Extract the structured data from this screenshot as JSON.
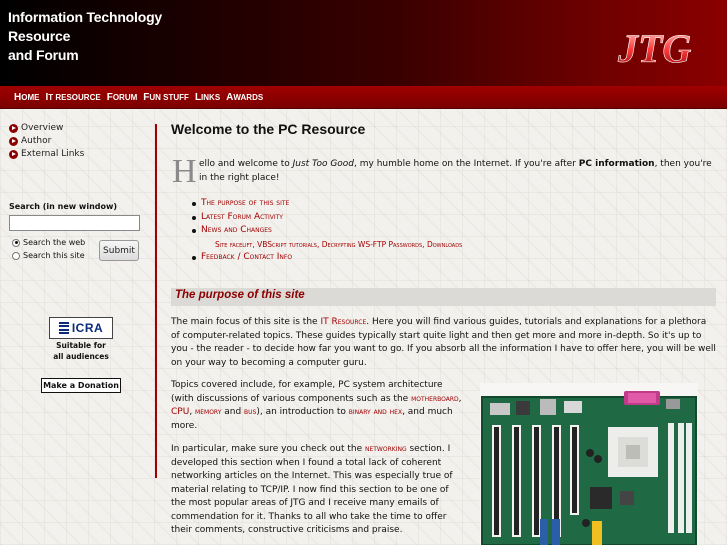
{
  "header": {
    "title_lines": [
      "Information Technology",
      "Resource",
      "and Forum"
    ],
    "logo_text": "JTG"
  },
  "nav": {
    "items": [
      "Home",
      "IT Resource",
      "Forum",
      "Fun Stuff",
      "Links",
      "Awards"
    ]
  },
  "sidebar": {
    "links": [
      "Overview",
      "Author",
      "External Links"
    ],
    "search": {
      "label": "Search (in new window)",
      "value": "",
      "options": [
        "Search the web",
        "Search this site"
      ],
      "selected": "Search the web",
      "submit_label": "Submit"
    },
    "icra": {
      "badge": "ICRA",
      "caption_line1": "Suitable for",
      "caption_line2": "all audiences"
    },
    "donate_label": "Make a Donation"
  },
  "main": {
    "title": "Welcome to the PC Resource",
    "intro": {
      "dropcap": "H",
      "part1": "ello and welcome to ",
      "site_name": "Just Too Good",
      "part2": ", my humble home on the Internet. If you're after ",
      "bold": "PC information",
      "part3": ", then you're in the right place!"
    },
    "toc": [
      "The purpose of this site",
      "Latest Forum Activity",
      "News and Changes",
      "Feedback / Contact Info"
    ],
    "toc_sub": [
      "Site facelift",
      "VBScript tutorials",
      "Decrypting WS-FTP Passwords",
      "Downloads"
    ],
    "section_heading": "The purpose of this site",
    "para1": {
      "a": "The main focus of this site is the ",
      "link": "IT Resource",
      "b": ". Here you will find various guides, tutorials and explanations for a plethora of computer-related topics. These guides typically start quite light and then get more and more in-depth. So it's up to you - the reader - to decide how far you want to go. If you absorb all the information I have to offer here, you will be well on your way to becoming a computer guru."
    },
    "para2": {
      "a": "Topics covered include, for example, PC system architecture (with discussions of various components such as the ",
      "l1": "motherboard",
      "s1": ",",
      "l2": "CPU",
      "s2": ", ",
      "l3": "memory",
      "s3": " and ",
      "l4": "bus",
      "s4": "), an introduction to ",
      "l5": "binary and hex",
      "b": ", and much more."
    },
    "para3": {
      "a": "In particular, make sure you check out the ",
      "link": "networking",
      "b": " section. I developed this section when I found a total lack of coherent networking articles on the Internet. This was especially true of material relating to TCP/IP. I now find this section to be one of the most popular areas of JTG and I receive many emails of commendation for it. Thanks to all who take the time to offer their comments, constructive criticisms and praise."
    }
  },
  "colors": {
    "accent": "#a00000",
    "header_dark": "#000000",
    "nav_bg": "#8a0000"
  }
}
